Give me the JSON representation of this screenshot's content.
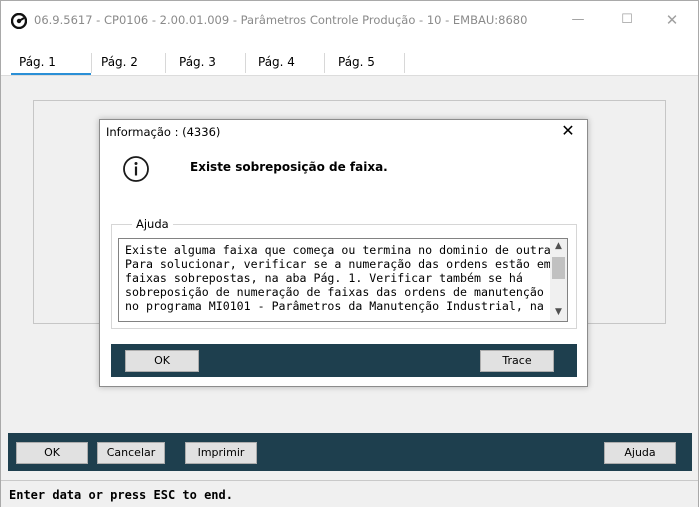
{
  "window": {
    "title": "06.9.5617 - CP0106 - 2.00.01.009 - Parâmetros Controle Produção - 10 - EMBAU:8680",
    "minimize": "—",
    "maximize": "☐",
    "close": "✕"
  },
  "tabs": [
    {
      "label": "Pág. 1",
      "active": true
    },
    {
      "label": "Pág. 2"
    },
    {
      "label": "Pág. 3"
    },
    {
      "label": "Pág. 4"
    },
    {
      "label": "Pág. 5"
    }
  ],
  "footer": {
    "ok_label": "OK",
    "cancel_label": "Cancelar",
    "print_label": "Imprimir",
    "help_label": "Ajuda"
  },
  "status": {
    "text": "Enter data or press ESC to end."
  },
  "dialog": {
    "title": "Informação : (4336)",
    "close": "✕",
    "message": "Existe sobreposição de faixa.",
    "group_label": "Ajuda",
    "help_lines": [
      "Existe alguma faixa que começa ou termina no dominio de outra.",
      "Para solucionar, verificar se a numeração das ordens estão em",
      "faixas sobrepostas, na aba Pág. 1. Verificar também se há",
      "sobreposição de numeração de faixas das ordens de manutenção",
      "no programa MI0101 - Parâmetros da Manutenção Industrial, na"
    ],
    "ok_label": "OK",
    "trace_label": "Trace"
  },
  "colors": {
    "bar": "#1e3f4e",
    "tab_accent": "#2a8fd6"
  }
}
